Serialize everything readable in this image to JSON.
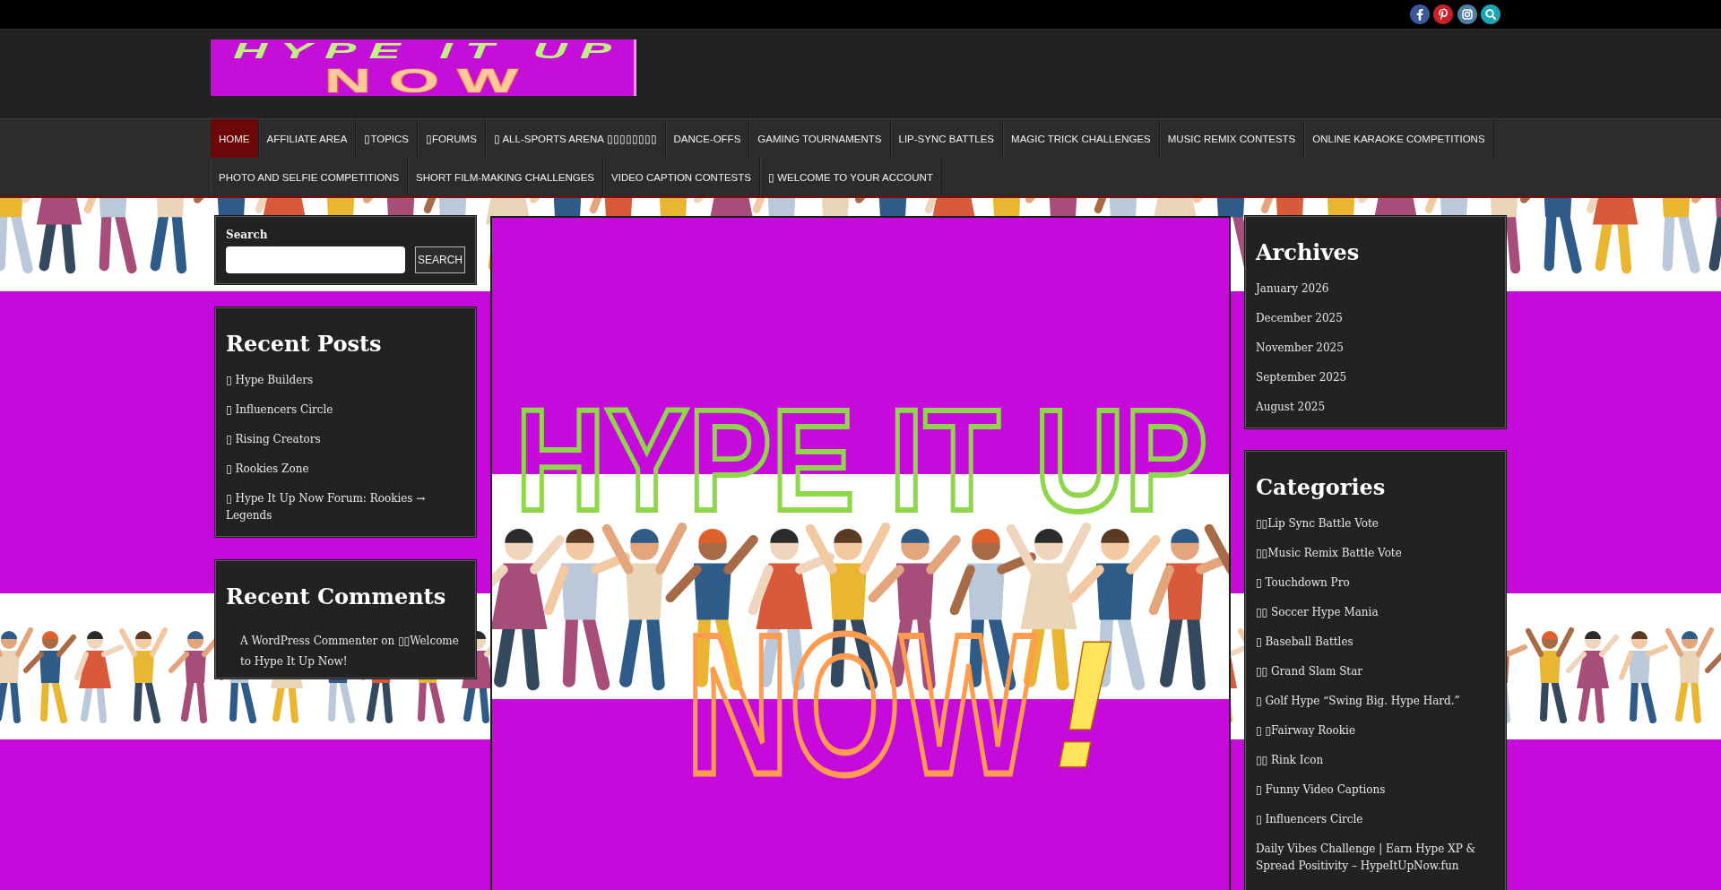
{
  "top_bar": {
    "social_links": [
      {
        "kind": "facebook",
        "color": "#3b5998"
      },
      {
        "kind": "pinterest",
        "color": "#cb2027"
      },
      {
        "kind": "instagram",
        "color": "#517fa4"
      },
      {
        "kind": "search",
        "color": "#1ea5b5"
      }
    ]
  },
  "header": {
    "logo": {
      "top_text": "HYPE IT UP",
      "bottom_text": "NOW"
    }
  },
  "nav": {
    "items": [
      {
        "label": "HOME",
        "selected": true
      },
      {
        "label": "AFFILIATE AREA",
        "selected": false
      },
      {
        "label": "▯TOPICS",
        "selected": false
      },
      {
        "label": "▯FORUMS",
        "selected": false
      },
      {
        "label": "▯ ALL-SPORTS ARENA ▯▯▯▯▯▯▯▯",
        "selected": false
      },
      {
        "label": "DANCE-OFFS",
        "selected": false
      },
      {
        "label": "GAMING TOURNAMENTS",
        "selected": false
      },
      {
        "label": "LIP-SYNC BATTLES",
        "selected": false
      },
      {
        "label": "MAGIC TRICK CHALLENGES",
        "selected": false
      },
      {
        "label": "MUSIC REMIX CONTESTS",
        "selected": false
      },
      {
        "label": "ONLINE KARAOKE COMPETITIONS",
        "selected": false
      },
      {
        "label": "PHOTO AND SELFIE COMPETITIONS",
        "selected": false
      },
      {
        "label": "SHORT FILM-MAKING CHALLENGES",
        "selected": false
      },
      {
        "label": "VIDEO CAPTION CONTESTS",
        "selected": false
      },
      {
        "label": "▯ WELCOME TO YOUR ACCOUNT",
        "selected": false
      }
    ]
  },
  "left_sidebar": {
    "search": {
      "label": "Search",
      "button": "SEARCH"
    },
    "recent_posts": {
      "title": "Recent Posts",
      "items": [
        "▯ Hype Builders",
        "▯ Influencers Circle",
        "▯ Rising Creators",
        "▯ Rookies Zone",
        "▯ Hype It Up Now Forum: Rookies → Legends"
      ]
    },
    "recent_comments": {
      "title": "Recent Comments",
      "items": [
        "A WordPress Commenter on ▯▯Welcome to Hype It Up Now!"
      ]
    }
  },
  "featured_image": {
    "top_text": "HYPE IT UP",
    "bottom_text": "NOW",
    "exclamation": "!"
  },
  "right_sidebar": {
    "archives": {
      "title": "Archives",
      "items": [
        "January 2026",
        "December 2025",
        "November 2025",
        "September 2025",
        "August 2025"
      ]
    },
    "categories": {
      "title": "Categories",
      "items": [
        "▯▯Lip Sync Battle Vote",
        "▯▯Music Remix Battle Vote",
        "▯ Touchdown Pro",
        "▯▯ Soccer Hype Mania",
        "▯ Baseball Battles",
        "▯▯ Grand Slam Star",
        "▯ Golf Hype “Swing Big. Hype Hard.”",
        "▯ ▯Fairway Rookie",
        "▯▯ Rink Icon",
        "▯ Funny Video Captions",
        "▯ Influencers Circle",
        "Daily Vibes Challenge | Earn Hype XP & Spread Positivity – HypeItUpNow.fun"
      ]
    }
  }
}
